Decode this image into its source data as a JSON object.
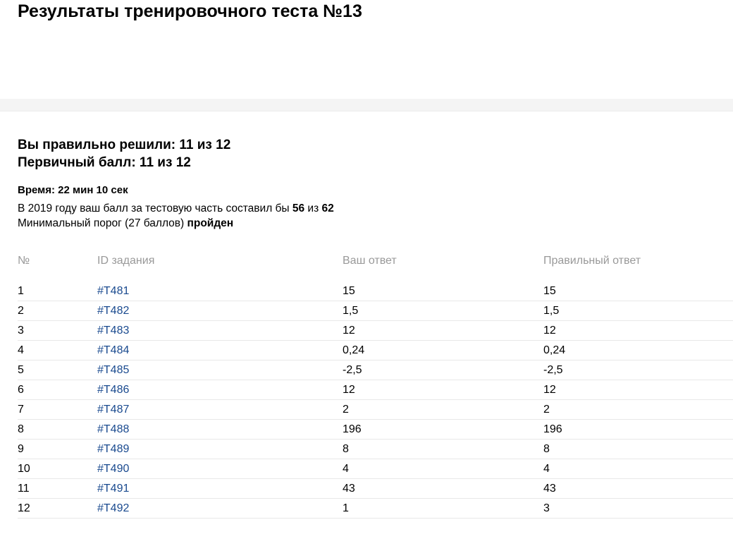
{
  "page": {
    "title": "Результаты тренировочного теста №13"
  },
  "summary": {
    "solved": "Вы правильно решили: 11 из 12",
    "primary_score": "Первичный балл: 11 из 12",
    "time": "Время: 22 мин 10 сек",
    "year_text_prefix": "В 2019 году ваш балл за тестовую часть составил бы ",
    "year_score": "56",
    "year_text_mid": " из ",
    "year_max": "62",
    "threshold_prefix": "Минимальный порог (27 баллов) ",
    "threshold_status": "пройден"
  },
  "table": {
    "headers": {
      "num": "№",
      "id": "ID задания",
      "your_answer": "Ваш ответ",
      "correct_answer": "Правильный ответ"
    },
    "rows": [
      {
        "num": "1",
        "id": "#T481",
        "answer": "15",
        "correct": "15",
        "is_wrong": false
      },
      {
        "num": "2",
        "id": "#T482",
        "answer": "1,5",
        "correct": "1,5",
        "is_wrong": false
      },
      {
        "num": "3",
        "id": "#T483",
        "answer": "12",
        "correct": "12",
        "is_wrong": false
      },
      {
        "num": "4",
        "id": "#T484",
        "answer": "0,24",
        "correct": "0,24",
        "is_wrong": false
      },
      {
        "num": "5",
        "id": "#T485",
        "answer": "-2,5",
        "correct": "-2,5",
        "is_wrong": false
      },
      {
        "num": "6",
        "id": "#T486",
        "answer": "12",
        "correct": "12",
        "is_wrong": false
      },
      {
        "num": "7",
        "id": "#T487",
        "answer": "2",
        "correct": "2",
        "is_wrong": false
      },
      {
        "num": "8",
        "id": "#T488",
        "answer": "196",
        "correct": "196",
        "is_wrong": false
      },
      {
        "num": "9",
        "id": "#T489",
        "answer": "8",
        "correct": "8",
        "is_wrong": false
      },
      {
        "num": "10",
        "id": "#T490",
        "answer": "4",
        "correct": "4",
        "is_wrong": false
      },
      {
        "num": "11",
        "id": "#T491",
        "answer": "43",
        "correct": "43",
        "is_wrong": false
      },
      {
        "num": "12",
        "id": "#T492",
        "answer": "1",
        "correct": "3",
        "is_wrong": true
      }
    ]
  },
  "colors": {
    "link": "#1a4a8f",
    "wrong_answer": "#d42a2a",
    "header_text": "#999999"
  }
}
